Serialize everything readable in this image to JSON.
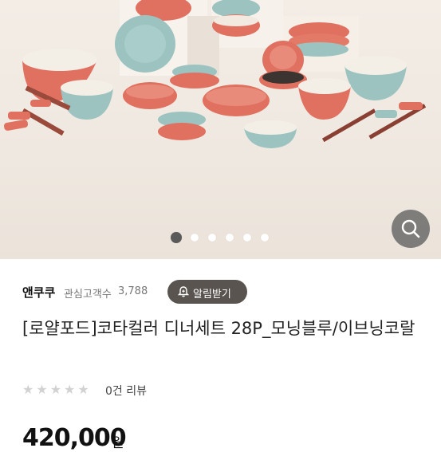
{
  "gallery": {
    "image_alt": "dinnerware set photo",
    "dot_count": 6,
    "active_index": 0,
    "zoom_icon": "search-icon"
  },
  "seller": {
    "name": "앤쿠쿠",
    "followers_label": "관심고객수",
    "followers_count": "3,788"
  },
  "alarm_button": {
    "label": "알림받기",
    "icon": "bell-plus-icon"
  },
  "product": {
    "title": "[로얄포드]코타컬러 디너세트 28P_모닝블루/이브닝코랄",
    "rating_stars": "★★★★★",
    "rating_value": 0,
    "review_text": "0건 리뷰",
    "price": "420,000",
    "currency": "원"
  },
  "colors": {
    "coral": "#e0705f",
    "blue": "#9cc3c0",
    "dark_button": "#595450"
  }
}
